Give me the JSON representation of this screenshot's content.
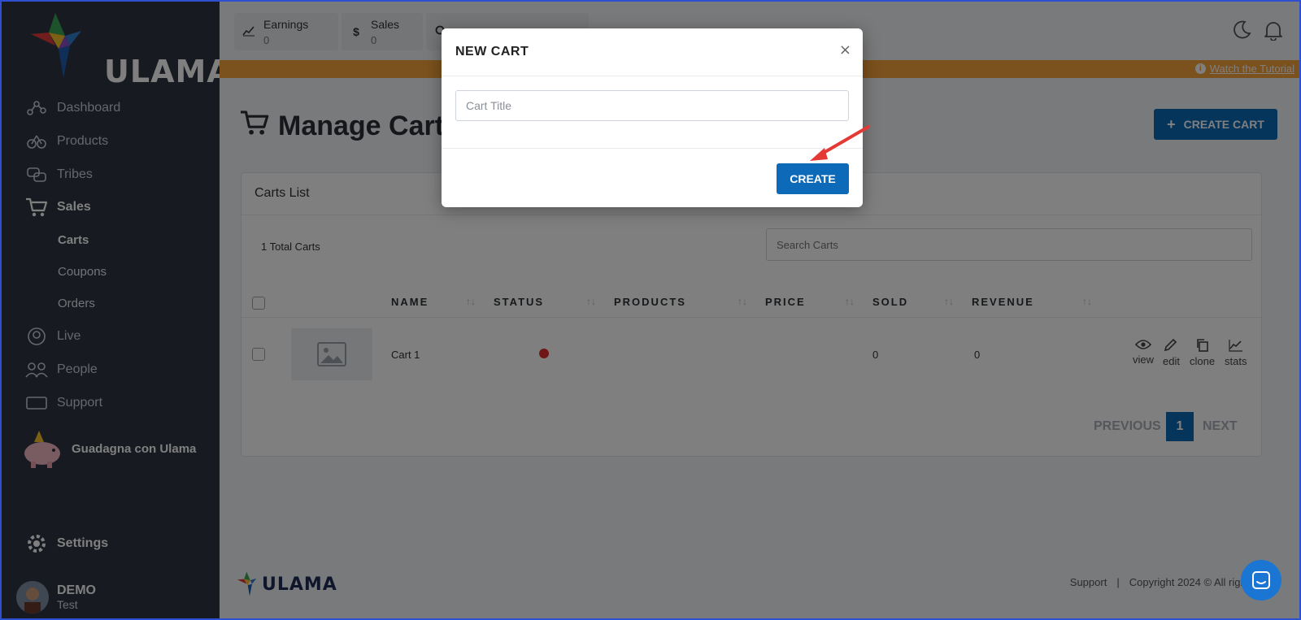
{
  "brand": {
    "name": "ULAMA"
  },
  "sidebar": {
    "items": [
      {
        "label": "Dashboard",
        "icon": "dashboard-icon"
      },
      {
        "label": "Products",
        "icon": "products-icon"
      },
      {
        "label": "Tribes",
        "icon": "tribes-icon"
      },
      {
        "label": "Sales",
        "icon": "cart-icon",
        "active": true
      },
      {
        "label": "Live",
        "icon": "live-icon"
      },
      {
        "label": "People",
        "icon": "people-icon"
      },
      {
        "label": "Support",
        "icon": "ticket-icon"
      }
    ],
    "sales_sub": [
      {
        "label": "Carts",
        "active": true
      },
      {
        "label": "Coupons"
      },
      {
        "label": "Orders"
      }
    ],
    "promo_label": "Guadagna con Ulama",
    "settings_label": "Settings",
    "user": {
      "name": "DEMO",
      "sub": "Test"
    }
  },
  "topbar": {
    "stats": [
      {
        "label": "Earnings",
        "value": "0",
        "icon": "chart-icon"
      },
      {
        "label": "Sales",
        "value": "0",
        "icon": "dollar-icon"
      }
    ],
    "tutorial_link": "Watch the Tutorial"
  },
  "main": {
    "title": "Manage Carts",
    "create_cart_label": "CREATE CART",
    "card_title": "Carts List",
    "total_label": "1 Total Carts",
    "search_placeholder": "Search Carts",
    "columns": [
      "NAME",
      "STATUS",
      "PRODUCTS",
      "PRICE",
      "SOLD",
      "REVENUE"
    ],
    "rows": [
      {
        "name": "Cart 1",
        "status_color": "#e02c2c",
        "products": "",
        "price": "",
        "sold": "0",
        "revenue": "0"
      }
    ],
    "actions": [
      "view",
      "edit",
      "clone",
      "stats"
    ],
    "pager": {
      "prev": "PREVIOUS",
      "page": "1",
      "next": "NEXT"
    }
  },
  "footer": {
    "brand": "ULAMA",
    "support": "Support",
    "separator": "|",
    "copyright": "Copyright 2024 © All rights re"
  },
  "modal": {
    "title": "NEW CART",
    "close": "×",
    "input_placeholder": "Cart Title",
    "input_value": "",
    "create_label": "CREATE"
  },
  "colors": {
    "accent": "#0c6ab8",
    "sidebar_bg": "#2f3643",
    "tutorial_bar": "#f7a23a",
    "status_inactive": "#e02c2c",
    "annotation_arrow": "#e53935"
  }
}
